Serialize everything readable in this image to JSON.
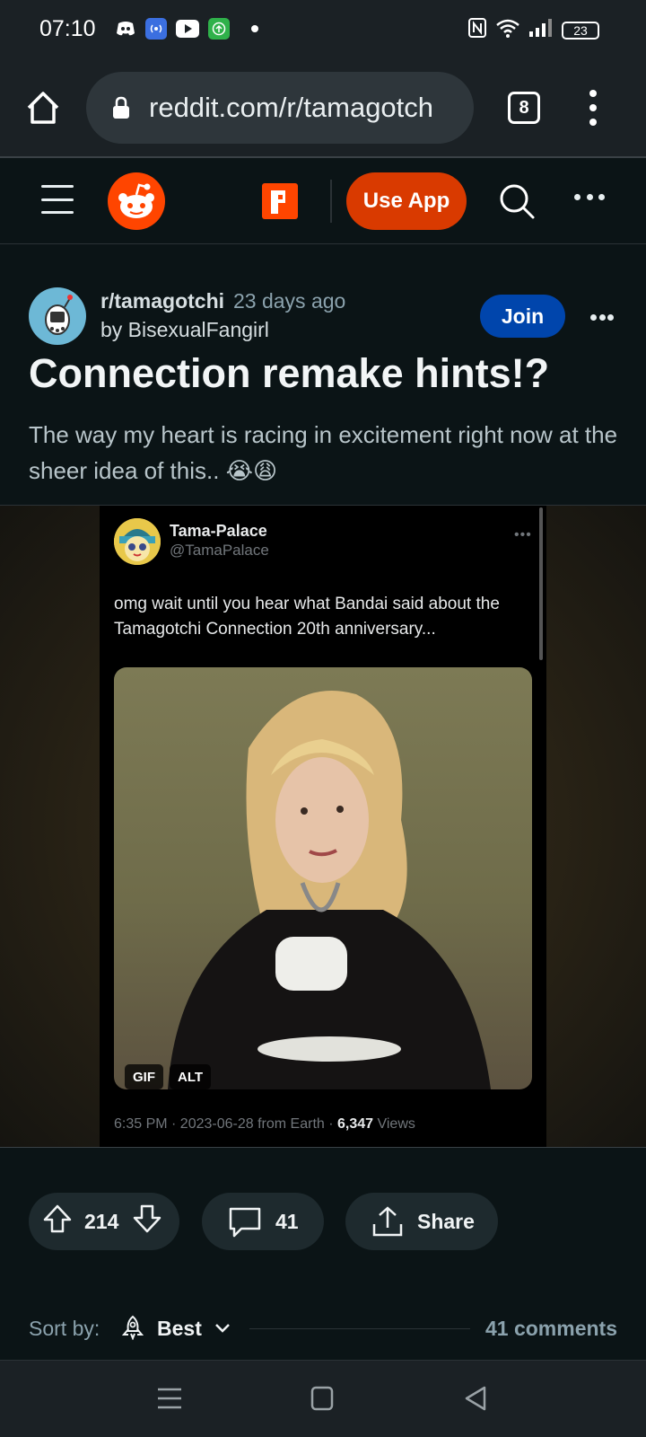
{
  "status_bar": {
    "time": "07:10",
    "battery": "23"
  },
  "browser": {
    "url": "reddit.com/r/tamagotch",
    "tab_count": "8"
  },
  "reddit_header": {
    "use_app_label": "Use App"
  },
  "post": {
    "subreddit": "r/tamagotchi",
    "time_ago": "23 days ago",
    "author_line": "by BisexualFangirl",
    "join_label": "Join",
    "title": "Connection remake hints!?",
    "body": "The way my heart is racing in excitement right now at the sheer idea of this.. 😭😩"
  },
  "tweet": {
    "display_name": "Tama-Palace",
    "handle": "@TamaPalace",
    "text": "omg wait until you hear what Bandai said about the Tamagotchi Connection 20th anniversary...",
    "badge_gif": "GIF",
    "badge_alt": "ALT",
    "meta_prefix": "6:35 PM · 2023-06-28 from Earth · ",
    "views_count": "6,347",
    "views_label": " Views"
  },
  "actions": {
    "score": "214",
    "comments": "41",
    "share_label": "Share"
  },
  "sort": {
    "label": "Sort by:",
    "value": "Best",
    "comment_count": "41 comments"
  },
  "colors": {
    "reddit_orange": "#ff4500",
    "join_blue": "#0045ac",
    "use_app": "#d93a00",
    "bg": "#0b1416"
  }
}
